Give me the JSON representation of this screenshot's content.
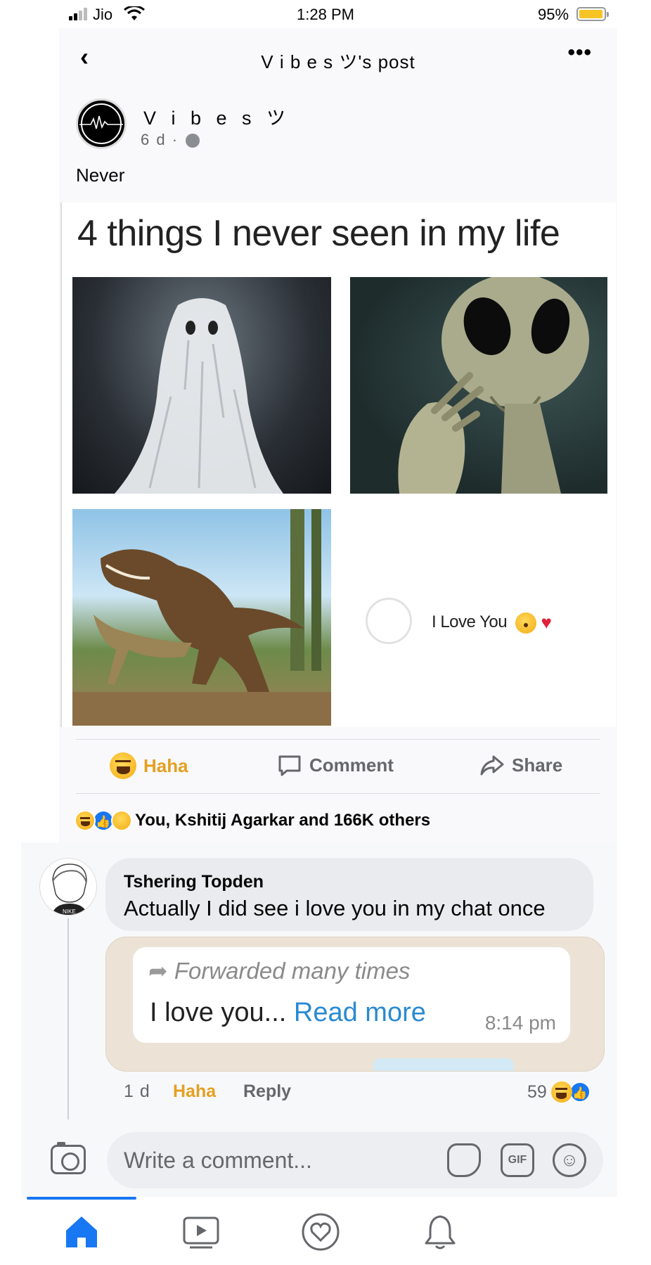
{
  "status_bar": {
    "carrier": "Jio",
    "time": "1:28 PM",
    "battery": "95%"
  },
  "header": {
    "title": "V i b e s ツ's post",
    "back_icon": "chevron-left-icon",
    "more_icon": "more-dots-icon"
  },
  "post": {
    "author": "V i b e s ツ",
    "age": "6 d ·",
    "privacy_icon": "globe-icon",
    "text": "Never",
    "meme": {
      "title": "4 things I never seen in my life",
      "panel_text": "I Love You"
    }
  },
  "actions": {
    "haha": "Haha",
    "comment": "Comment",
    "share": "Share"
  },
  "reactions_summary": "You, Kshitij Agarkar and 166K others",
  "comment": {
    "author": "Tshering Topden",
    "text": "Actually I did see i love you in my chat once",
    "attachment": {
      "forwarded": "Forwarded many times",
      "message": "I love you... ",
      "read_more": "Read more",
      "time": "8:14 pm"
    },
    "age": "1 d",
    "haha": "Haha",
    "reply": "Reply",
    "reaction_count": "59"
  },
  "composer": {
    "placeholder": "Write a comment...",
    "gif_label": "GIF"
  },
  "colors": {
    "accent": "#1877f2",
    "haha": "#e4a020",
    "muted": "#65676b"
  },
  "nav": [
    "home-icon",
    "video-icon",
    "dating-icon",
    "notifications-icon"
  ]
}
